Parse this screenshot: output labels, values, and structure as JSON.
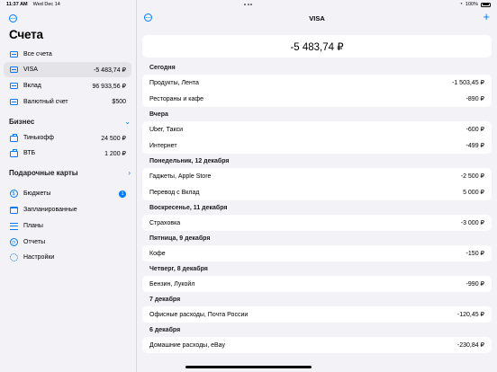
{
  "status": {
    "time": "11:37 AM",
    "date": "Wed Dec 14",
    "battery": "100%"
  },
  "sidebar": {
    "title": "Счета",
    "accounts": [
      {
        "label": "Все счета",
        "value": ""
      },
      {
        "label": "VISA",
        "value": "-5 483,74 ₽"
      },
      {
        "label": "Вклад",
        "value": "96 933,56 ₽"
      },
      {
        "label": "Валютный счет",
        "value": "$500"
      }
    ],
    "business_title": "Бизнес",
    "business": [
      {
        "label": "Тинькофф",
        "value": "24 500 ₽"
      },
      {
        "label": "ВТБ",
        "value": "1 200 ₽"
      }
    ],
    "gift_title": "Подарочные карты",
    "nav": [
      {
        "label": "Бюджеты",
        "badge": "1"
      },
      {
        "label": "Запланированные"
      },
      {
        "label": "Планы"
      },
      {
        "label": "Отчеты"
      },
      {
        "label": "Настройки"
      }
    ]
  },
  "main": {
    "title": "VISA",
    "balance": "-5 483,74 ₽",
    "groups": [
      {
        "date": "Сегодня",
        "items": [
          {
            "name": "Продукты, Лента",
            "amount": "-1 503,45 ₽"
          },
          {
            "name": "Рестораны и кафе",
            "amount": "-890 ₽"
          }
        ]
      },
      {
        "date": "Вчера",
        "items": [
          {
            "name": "Uber, Такси",
            "amount": "-600 ₽"
          },
          {
            "name": "Интернет",
            "amount": "-499 ₽"
          }
        ]
      },
      {
        "date": "Понедельник, 12 декабря",
        "items": [
          {
            "name": "Гаджеты, Apple Store",
            "amount": "-2 500 ₽"
          },
          {
            "name": "Перевод с Вклад",
            "amount": "5 000 ₽"
          }
        ]
      },
      {
        "date": "Воскресенье, 11 декабря",
        "items": [
          {
            "name": "Страховка",
            "amount": "-3 000 ₽"
          }
        ]
      },
      {
        "date": "Пятница, 9 декабря",
        "items": [
          {
            "name": "Кофе",
            "amount": "-150 ₽"
          }
        ]
      },
      {
        "date": "Четверг, 8 декабря",
        "items": [
          {
            "name": "Бензин, Лукойл",
            "amount": "-990 ₽"
          }
        ]
      },
      {
        "date": "7 декабря",
        "items": [
          {
            "name": "Офисные расходы, Почта России",
            "amount": "-120,45 ₽"
          }
        ]
      },
      {
        "date": "6 декабря",
        "items": [
          {
            "name": "Домашние расходы, eBay",
            "amount": "-230,84 ₽"
          }
        ]
      }
    ]
  }
}
